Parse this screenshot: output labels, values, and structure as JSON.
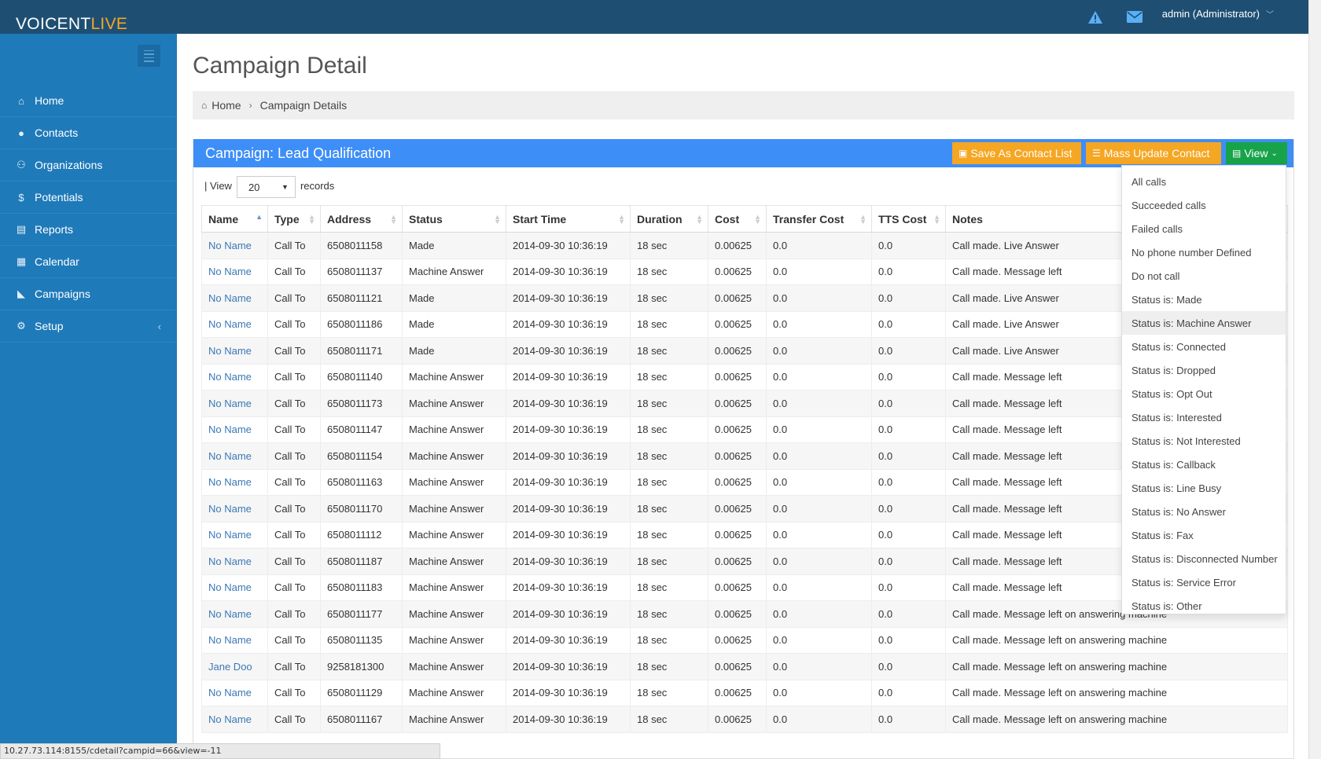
{
  "brand": {
    "voicent": "VOICENT",
    "live": "LIVE"
  },
  "header": {
    "user": "admin (Administrator)"
  },
  "sidebar": {
    "items": [
      {
        "label": "Home",
        "icon": "home-icon",
        "glyph": "⌂"
      },
      {
        "label": "Contacts",
        "icon": "user-icon",
        "glyph": "●"
      },
      {
        "label": "Organizations",
        "icon": "sitemap-icon",
        "glyph": "⚇"
      },
      {
        "label": "Potentials",
        "icon": "dollar-icon",
        "glyph": "$"
      },
      {
        "label": "Reports",
        "icon": "file-icon",
        "glyph": "▤"
      },
      {
        "label": "Calendar",
        "icon": "calendar-icon",
        "glyph": "▦"
      },
      {
        "label": "Campaigns",
        "icon": "rss-icon",
        "glyph": "◣"
      },
      {
        "label": "Setup",
        "icon": "gears-icon",
        "glyph": "⚙"
      }
    ]
  },
  "page": {
    "title": "Campaign Detail"
  },
  "breadcrumb": {
    "home": "Home",
    "current": "Campaign Details"
  },
  "panel": {
    "title": "Campaign: Lead Qualification",
    "save_label": "Save As Contact List",
    "mass_label": "Mass Update Contact",
    "view_label": "View"
  },
  "records": {
    "view_label": "| View",
    "value": "20",
    "suffix": "records"
  },
  "table": {
    "headers": [
      "Name",
      "Type",
      "Address",
      "Status",
      "Start Time",
      "Duration",
      "Cost",
      "Transfer Cost",
      "TTS Cost",
      "Notes"
    ],
    "rows": [
      [
        "No Name",
        "Call To",
        "6508011158",
        "Made",
        "2014-09-30 10:36:19",
        "18 sec",
        "0.00625",
        "0.0",
        "0.0",
        "Call made. Live Answer"
      ],
      [
        "No Name",
        "Call To",
        "6508011137",
        "Machine Answer",
        "2014-09-30 10:36:19",
        "18 sec",
        "0.00625",
        "0.0",
        "0.0",
        "Call made. Message left"
      ],
      [
        "No Name",
        "Call To",
        "6508011121",
        "Made",
        "2014-09-30 10:36:19",
        "18 sec",
        "0.00625",
        "0.0",
        "0.0",
        "Call made. Live Answer"
      ],
      [
        "No Name",
        "Call To",
        "6508011186",
        "Made",
        "2014-09-30 10:36:19",
        "18 sec",
        "0.00625",
        "0.0",
        "0.0",
        "Call made. Live Answer"
      ],
      [
        "No Name",
        "Call To",
        "6508011171",
        "Made",
        "2014-09-30 10:36:19",
        "18 sec",
        "0.00625",
        "0.0",
        "0.0",
        "Call made. Live Answer"
      ],
      [
        "No Name",
        "Call To",
        "6508011140",
        "Machine Answer",
        "2014-09-30 10:36:19",
        "18 sec",
        "0.00625",
        "0.0",
        "0.0",
        "Call made. Message left"
      ],
      [
        "No Name",
        "Call To",
        "6508011173",
        "Machine Answer",
        "2014-09-30 10:36:19",
        "18 sec",
        "0.00625",
        "0.0",
        "0.0",
        "Call made. Message left"
      ],
      [
        "No Name",
        "Call To",
        "6508011147",
        "Machine Answer",
        "2014-09-30 10:36:19",
        "18 sec",
        "0.00625",
        "0.0",
        "0.0",
        "Call made. Message left"
      ],
      [
        "No Name",
        "Call To",
        "6508011154",
        "Machine Answer",
        "2014-09-30 10:36:19",
        "18 sec",
        "0.00625",
        "0.0",
        "0.0",
        "Call made. Message left"
      ],
      [
        "No Name",
        "Call To",
        "6508011163",
        "Machine Answer",
        "2014-09-30 10:36:19",
        "18 sec",
        "0.00625",
        "0.0",
        "0.0",
        "Call made. Message left"
      ],
      [
        "No Name",
        "Call To",
        "6508011170",
        "Machine Answer",
        "2014-09-30 10:36:19",
        "18 sec",
        "0.00625",
        "0.0",
        "0.0",
        "Call made. Message left"
      ],
      [
        "No Name",
        "Call To",
        "6508011112",
        "Machine Answer",
        "2014-09-30 10:36:19",
        "18 sec",
        "0.00625",
        "0.0",
        "0.0",
        "Call made. Message left"
      ],
      [
        "No Name",
        "Call To",
        "6508011187",
        "Machine Answer",
        "2014-09-30 10:36:19",
        "18 sec",
        "0.00625",
        "0.0",
        "0.0",
        "Call made. Message left"
      ],
      [
        "No Name",
        "Call To",
        "6508011183",
        "Machine Answer",
        "2014-09-30 10:36:19",
        "18 sec",
        "0.00625",
        "0.0",
        "0.0",
        "Call made. Message left"
      ],
      [
        "No Name",
        "Call To",
        "6508011177",
        "Machine Answer",
        "2014-09-30 10:36:19",
        "18 sec",
        "0.00625",
        "0.0",
        "0.0",
        "Call made. Message left on answering machine"
      ],
      [
        "No Name",
        "Call To",
        "6508011135",
        "Machine Answer",
        "2014-09-30 10:36:19",
        "18 sec",
        "0.00625",
        "0.0",
        "0.0",
        "Call made. Message left on answering machine"
      ],
      [
        "Jane Doo",
        "Call To",
        "9258181300",
        "Machine Answer",
        "2014-09-30 10:36:19",
        "18 sec",
        "0.00625",
        "0.0",
        "0.0",
        "Call made. Message left on answering machine"
      ],
      [
        "No Name",
        "Call To",
        "6508011129",
        "Machine Answer",
        "2014-09-30 10:36:19",
        "18 sec",
        "0.00625",
        "0.0",
        "0.0",
        "Call made. Message left on answering machine"
      ],
      [
        "No Name",
        "Call To",
        "6508011167",
        "Machine Answer",
        "2014-09-30 10:36:19",
        "18 sec",
        "0.00625",
        "0.0",
        "0.0",
        "Call made. Message left on answering machine"
      ]
    ]
  },
  "view_menu": {
    "items": [
      "All calls",
      "Succeeded calls",
      "Failed calls",
      "No phone number Defined",
      "Do not call",
      "Status is: Made",
      "Status is: Machine Answer",
      "Status is: Connected",
      "Status is: Dropped",
      "Status is: Opt Out",
      "Status is: Interested",
      "Status is: Not Interested",
      "Status is: Callback",
      "Status is: Line Busy",
      "Status is: No Answer",
      "Status is: Fax",
      "Status is: Disconnected Number",
      "Status is: Service Error",
      "Status is: Other"
    ],
    "hovered": "Status is: Machine Answer"
  },
  "statusbar": {
    "url": "10.27.73.114:8155/cdetail?campid=66&view=-11"
  },
  "colors": {
    "topbar": "#1e4f73",
    "sidebar": "#1f7ab9",
    "panel_header": "#3e8ef7",
    "orange": "#f5a623",
    "green": "#17a34a",
    "link": "#3c78b5"
  }
}
